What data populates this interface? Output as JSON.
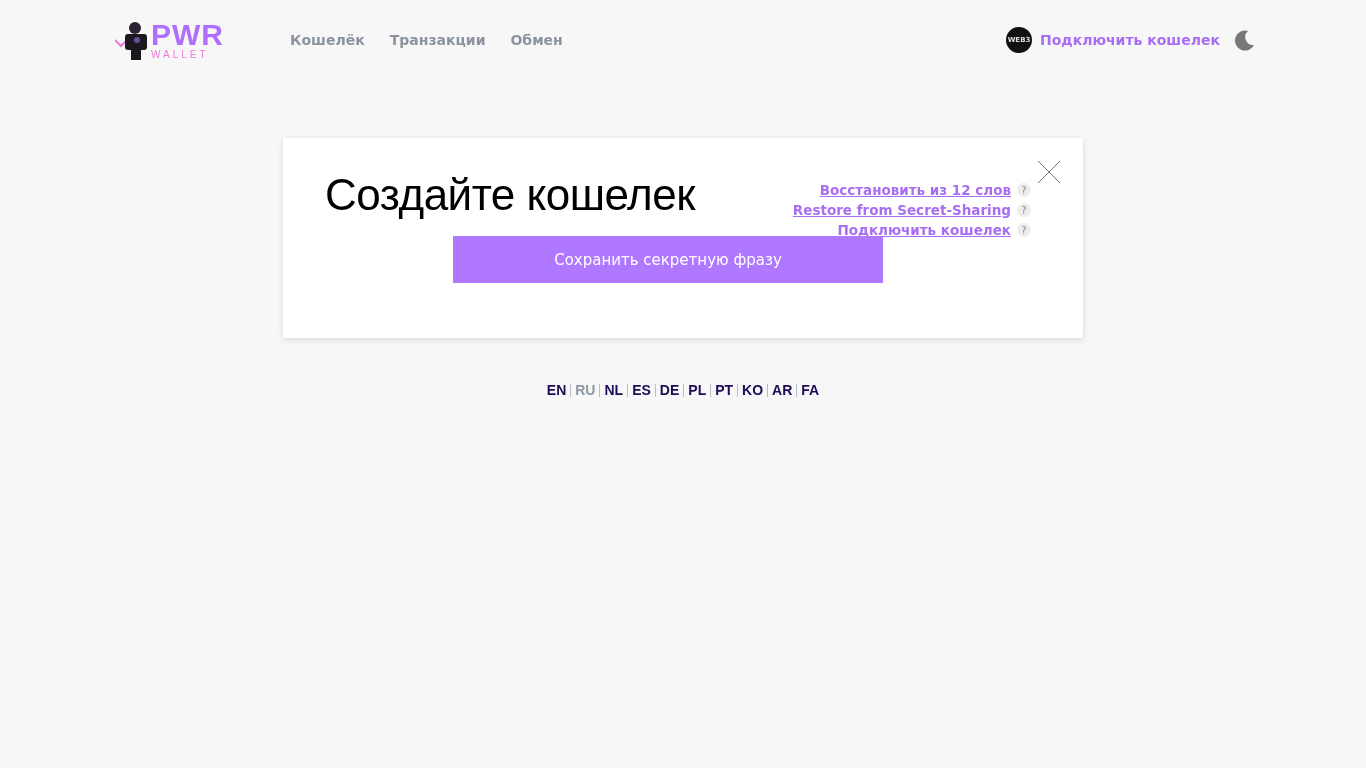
{
  "header": {
    "logo": {
      "main": "PWR",
      "sub": "WALLET"
    },
    "nav": [
      {
        "label": "Кошелёк"
      },
      {
        "label": "Транзакции"
      },
      {
        "label": "Обмен"
      }
    ],
    "connect": {
      "badge": "WEB3",
      "label": "Подключить кошелек"
    }
  },
  "card": {
    "title": "Создайте кошелек",
    "links": [
      {
        "label": "Восстановить из 12 слов",
        "help": "?"
      },
      {
        "label": "Restore from Secret-Sharing",
        "help": "?"
      },
      {
        "label": "Подключить кошелек",
        "help": "?"
      }
    ],
    "button": "Сохранить секретную фразу"
  },
  "languages": [
    {
      "code": "EN",
      "selected": false
    },
    {
      "code": "RU",
      "selected": true
    },
    {
      "code": "NL",
      "selected": false
    },
    {
      "code": "ES",
      "selected": false
    },
    {
      "code": "DE",
      "selected": false
    },
    {
      "code": "PL",
      "selected": false
    },
    {
      "code": "PT",
      "selected": false
    },
    {
      "code": "KO",
      "selected": false
    },
    {
      "code": "AR",
      "selected": false
    },
    {
      "code": "FA",
      "selected": false
    }
  ]
}
